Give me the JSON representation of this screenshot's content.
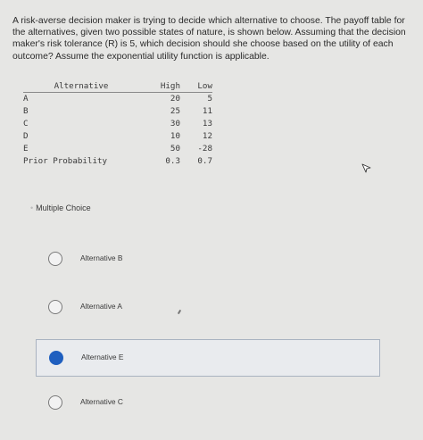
{
  "question": {
    "text": "A risk-averse decision maker is trying to decide which alternative to choose. The payoff table for the alternatives, given two possible states of nature, is shown below. Assuming that the decision maker's risk tolerance (R) is 5, which decision should she choose based on the utility of each outcome? Assume the exponential utility function is applicable."
  },
  "table": {
    "header": {
      "alternative": "Alternative",
      "high": "High",
      "low": "Low"
    },
    "rows": [
      {
        "label": "A",
        "high": "20",
        "low": "5"
      },
      {
        "label": "B",
        "high": "25",
        "low": "11"
      },
      {
        "label": "C",
        "high": "30",
        "low": "13"
      },
      {
        "label": "D",
        "high": "10",
        "low": "12"
      },
      {
        "label": "E",
        "high": "50",
        "low": "-28"
      },
      {
        "label": "Prior Probability",
        "high": "0.3",
        "low": "0.7"
      }
    ]
  },
  "multiple_choice": {
    "label": "Multiple Choice",
    "options": [
      {
        "text": "Alternative B",
        "selected": false
      },
      {
        "text": "Alternative A",
        "selected": false
      },
      {
        "text": "Alternative E",
        "selected": true
      },
      {
        "text": "Alternative C",
        "selected": false
      }
    ]
  },
  "icons": {
    "cursor": "mouse-pointer-icon"
  },
  "colors": {
    "selected_radio": "#1f5fbf",
    "background": "#e6e6e4"
  }
}
